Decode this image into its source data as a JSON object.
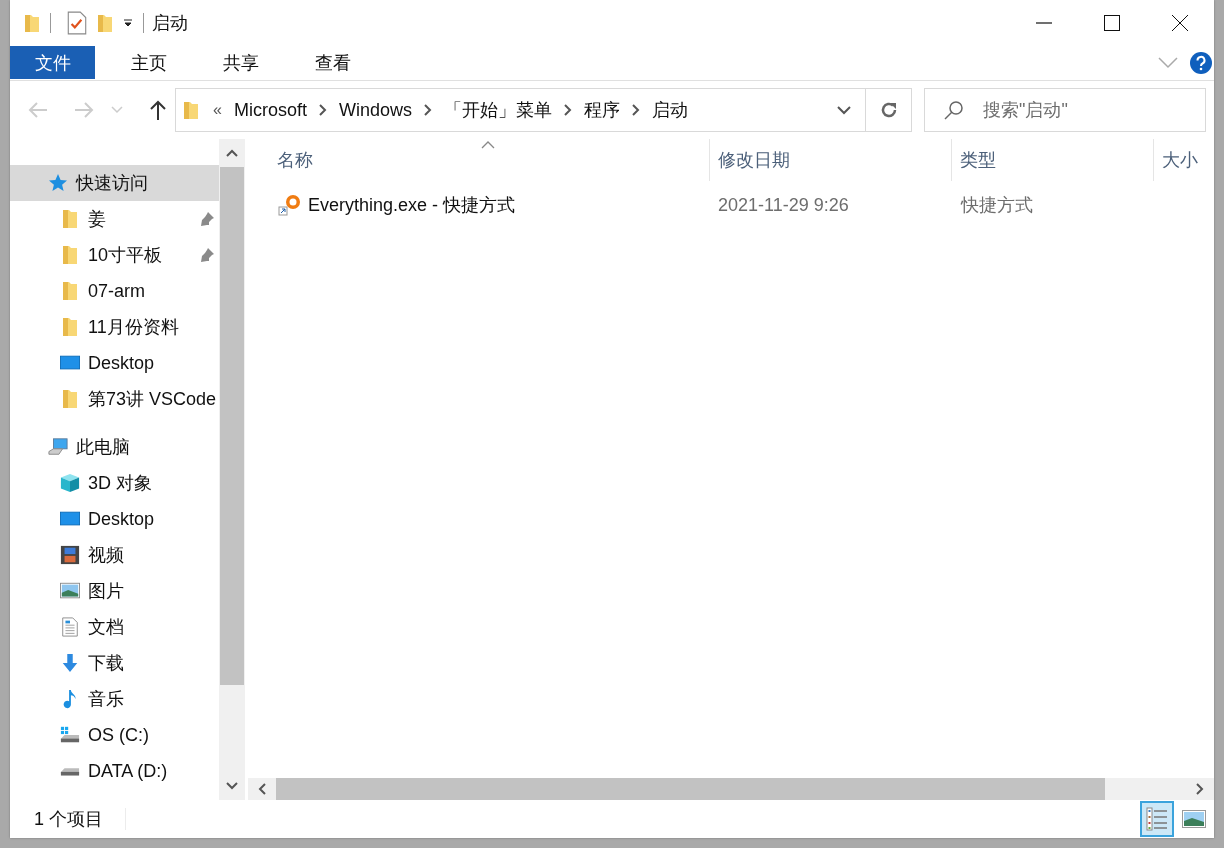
{
  "window": {
    "title": "启动"
  },
  "ribbon": {
    "tabs": [
      {
        "label": "文件",
        "selected": true
      },
      {
        "label": "主页",
        "selected": false
      },
      {
        "label": "共享",
        "selected": false
      },
      {
        "label": "查看",
        "selected": false
      }
    ]
  },
  "nav_buttons": [
    {
      "kind": "back",
      "disabled": true
    },
    {
      "kind": "forward",
      "disabled": true
    },
    {
      "kind": "recent",
      "disabled": true
    },
    {
      "kind": "up",
      "disabled": false
    }
  ],
  "address": {
    "overflow_mark": "«",
    "segments": [
      "Microsoft",
      "Windows",
      "「开始」菜单",
      "程序",
      "启动"
    ]
  },
  "search": {
    "placeholder": "搜索\"启动\""
  },
  "sidebar": {
    "items": [
      {
        "label": "快速访问",
        "kind": "star",
        "selected": true,
        "children": [
          {
            "label": "姜",
            "kind": "folder",
            "pinned": true,
            "selected": false
          },
          {
            "label": "10寸平板",
            "kind": "folder",
            "pinned": true,
            "selected": false
          },
          {
            "label": "07-arm",
            "kind": "folder",
            "pinned": false,
            "selected": false
          },
          {
            "label": "11月份资料",
            "kind": "folder",
            "pinned": false,
            "selected": false
          },
          {
            "label": "Desktop",
            "kind": "desktop",
            "pinned": false,
            "selected": false
          },
          {
            "label": "第73讲 VSCode",
            "kind": "folder",
            "pinned": false,
            "selected": false
          }
        ]
      },
      {
        "label": "此电脑",
        "kind": "pc",
        "selected": false,
        "children": [
          {
            "label": "3D 对象",
            "kind": "cube",
            "selected": false
          },
          {
            "label": "Desktop",
            "kind": "desktop",
            "selected": false
          },
          {
            "label": "视频",
            "kind": "video",
            "selected": false
          },
          {
            "label": "图片",
            "kind": "pictures",
            "selected": false
          },
          {
            "label": "文档",
            "kind": "documents",
            "selected": false
          },
          {
            "label": "下载",
            "kind": "downloads",
            "selected": false
          },
          {
            "label": "音乐",
            "kind": "music",
            "selected": false
          },
          {
            "label": "OS (C:)",
            "kind": "drive-os",
            "selected": false
          },
          {
            "label": "DATA (D:)",
            "kind": "drive",
            "selected": false
          }
        ]
      }
    ]
  },
  "table": {
    "columns": [
      {
        "label": "名称",
        "sorted": true
      },
      {
        "label": "修改日期",
        "sorted": false
      },
      {
        "label": "类型",
        "sorted": false
      },
      {
        "label": "大小",
        "sorted": false
      }
    ],
    "rows": [
      {
        "name": "Everything.exe - 快捷方式",
        "date": "2021-11-29 9:26",
        "type": "快捷方式",
        "selected": false
      }
    ]
  },
  "status_bar": {
    "text": "1 个项目"
  },
  "view_buttons": [
    {
      "kind": "details",
      "selected": true
    },
    {
      "kind": "large-icons",
      "selected": false
    }
  ]
}
